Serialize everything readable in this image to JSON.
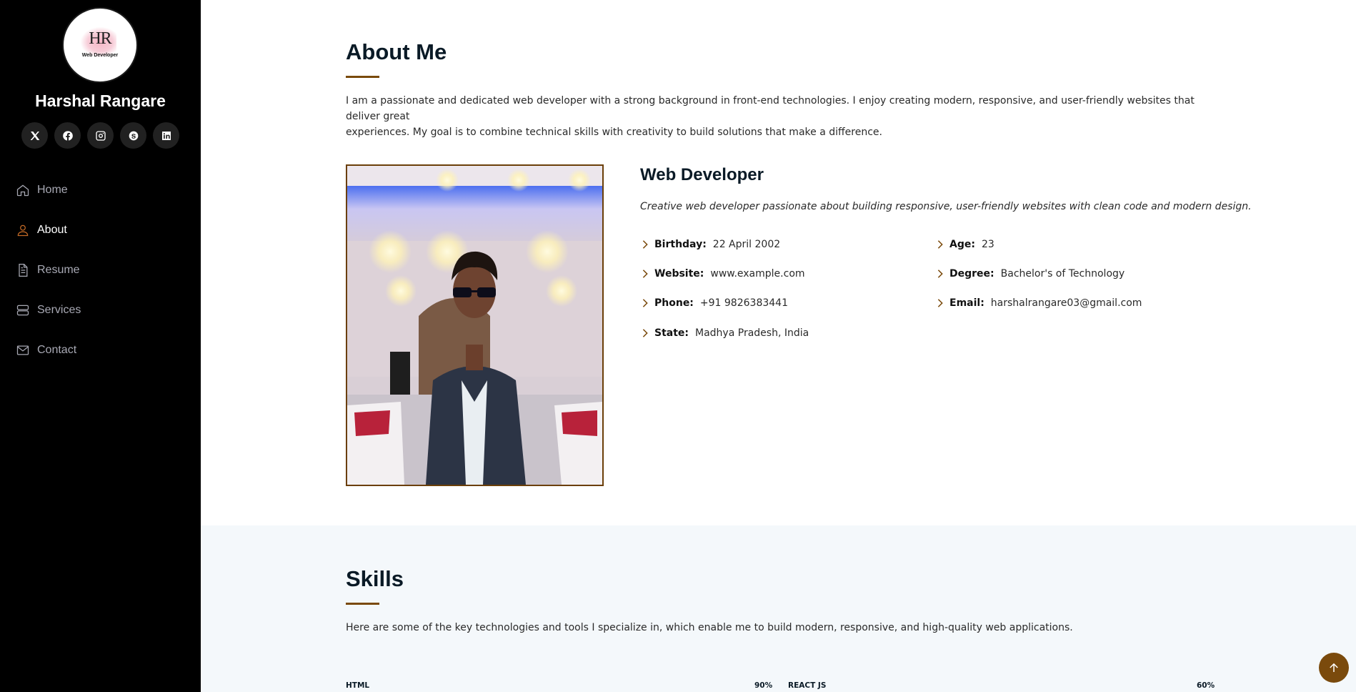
{
  "profile": {
    "logo_monogram": "HR",
    "logo_caption": "Web Developer",
    "name": "Harshal Rangare"
  },
  "socials": [
    {
      "icon": "x-twitter-icon"
    },
    {
      "icon": "facebook-icon"
    },
    {
      "icon": "instagram-icon"
    },
    {
      "icon": "skype-icon"
    },
    {
      "icon": "linkedin-icon"
    }
  ],
  "nav": {
    "items": [
      {
        "label": "Home",
        "icon": "home-icon"
      },
      {
        "label": "About",
        "icon": "person-icon",
        "active": true
      },
      {
        "label": "Resume",
        "icon": "file-icon"
      },
      {
        "label": "Services",
        "icon": "server-icon"
      },
      {
        "label": "Contact",
        "icon": "envelope-icon"
      }
    ]
  },
  "about": {
    "title": "About Me",
    "description_line1": "I am a passionate and dedicated web developer with a strong background in front-end technologies. I enjoy creating modern, responsive, and user-friendly websites that deliver great",
    "description_line2": "experiences. My goal is to combine technical skills with creativity to build solutions that make a difference.",
    "role_title": "Web Developer",
    "role_description": "Creative web developer passionate about building responsive, user-friendly websites with clean code and modern design.",
    "info_left": [
      {
        "label": "Birthday:",
        "value": "22 April 2002"
      },
      {
        "label": "Website:",
        "value": "www.example.com"
      },
      {
        "label": "Phone:",
        "value": "+91 9826383441"
      },
      {
        "label": "State:",
        "value": "Madhya Pradesh, India"
      }
    ],
    "info_right": [
      {
        "label": "Age:",
        "value": "23"
      },
      {
        "label": "Degree:",
        "value": "Bachelor's of Technology"
      },
      {
        "label": "Email:",
        "value": "harshalrangare03@gmail.com"
      }
    ]
  },
  "skills": {
    "title": "Skills",
    "description": "Here are some of the key technologies and tools I specialize in, which enable me to build modern, responsive, and high-quality web applications.",
    "items": [
      {
        "name": "HTML",
        "percent_label": "90%",
        "level": 90
      },
      {
        "name": "REACT JS",
        "percent_label": "60%",
        "level": 60
      }
    ]
  },
  "colors": {
    "accent": "#7a4a0c",
    "sidebar_bg": "#000000",
    "active_icon": "#c46a26",
    "skills_bg": "#f4f8fb"
  }
}
